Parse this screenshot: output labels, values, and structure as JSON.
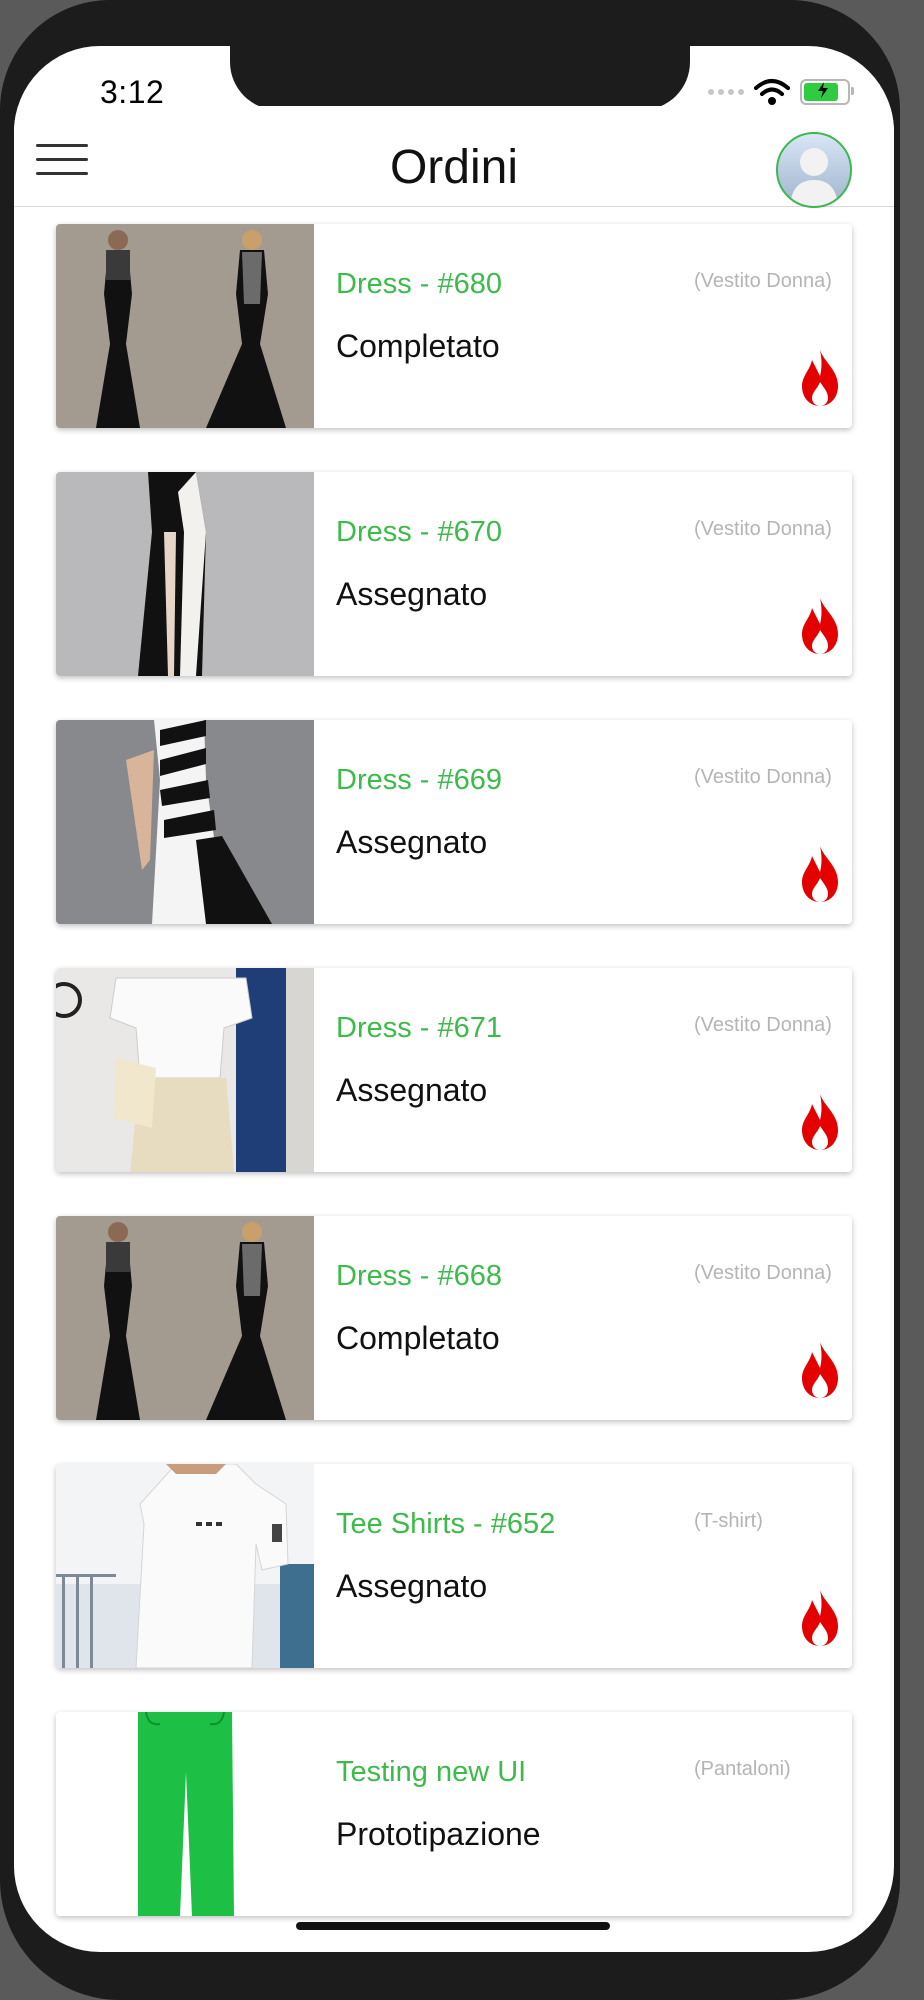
{
  "status_bar": {
    "time": "3:12",
    "battery_color": "#2ecc40"
  },
  "header": {
    "title": "Ordini",
    "menu_icon": "hamburger-menu-icon",
    "avatar_icon": "user-avatar-icon"
  },
  "colors": {
    "accent_green": "#3dbb4a",
    "flame_red": "#e50000"
  },
  "orders": [
    {
      "title": "Dress - #680",
      "category": "(Vestito Donna)",
      "status": "Completato",
      "hot": true,
      "thumb": "black-evening-dress"
    },
    {
      "title": "Dress - #670",
      "category": "(Vestito Donna)",
      "status": "Assegnato",
      "hot": true,
      "thumb": "black-white-split-dress"
    },
    {
      "title": "Dress - #669",
      "category": "(Vestito Donna)",
      "status": "Assegnato",
      "hot": true,
      "thumb": "striped-strapless-dress"
    },
    {
      "title": "Dress - #671",
      "category": "(Vestito Donna)",
      "status": "Assegnato",
      "hot": true,
      "thumb": "white-shirt-outfit"
    },
    {
      "title": "Dress - #668",
      "category": "(Vestito Donna)",
      "status": "Completato",
      "hot": true,
      "thumb": "black-evening-dress"
    },
    {
      "title": "Tee Shirts - #652",
      "category": "(T-shirt)",
      "status": "Assegnato",
      "hot": true,
      "thumb": "white-tshirt"
    },
    {
      "title": "Testing new UI",
      "category": "(Pantaloni)",
      "status": "Prototipazione",
      "hot": false,
      "thumb": "green-pants"
    }
  ]
}
